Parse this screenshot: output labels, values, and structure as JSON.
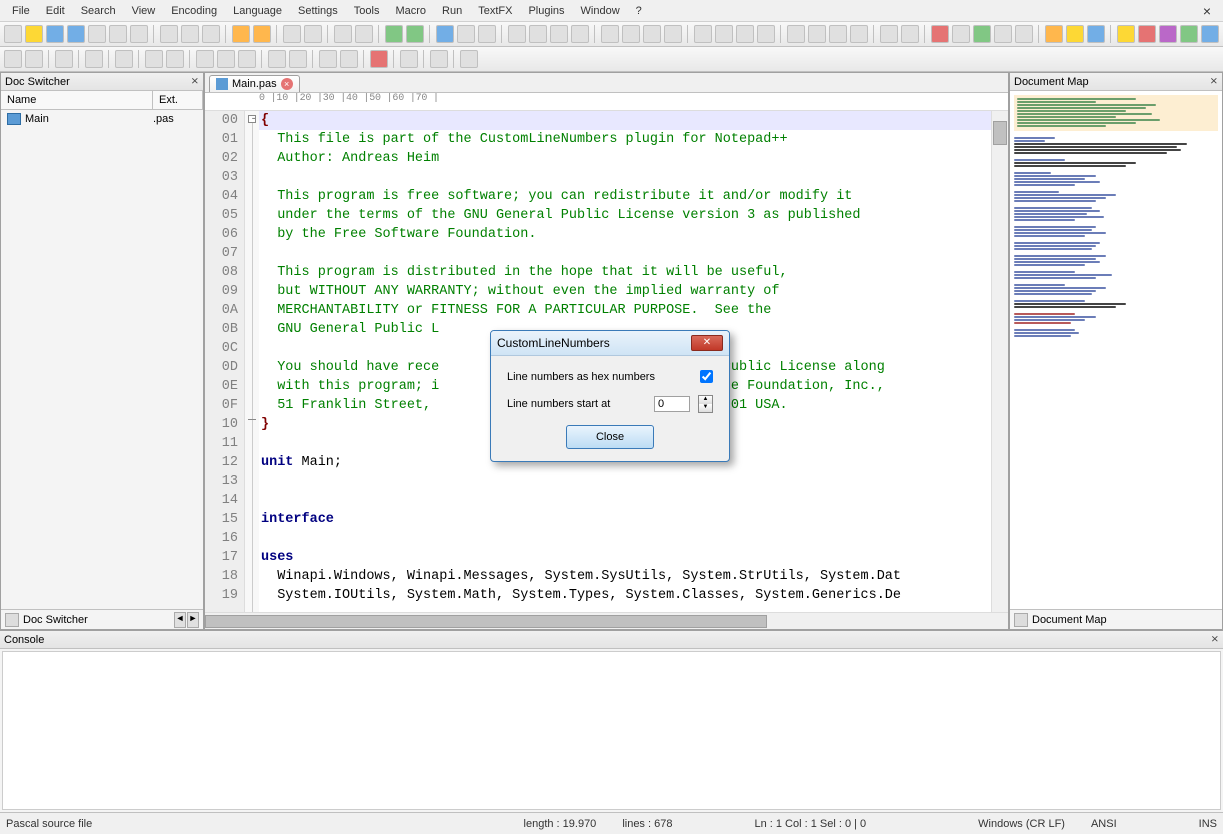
{
  "menu": [
    "File",
    "Edit",
    "Search",
    "View",
    "Encoding",
    "Language",
    "Settings",
    "Tools",
    "Macro",
    "Run",
    "TextFX",
    "Plugins",
    "Window",
    "?"
  ],
  "doc_switcher": {
    "title": "Doc Switcher",
    "col_name": "Name",
    "col_ext": "Ext.",
    "files": [
      {
        "name": "Main",
        "ext": ".pas"
      }
    ],
    "footer": "Doc Switcher"
  },
  "tab": {
    "label": "Main.pas"
  },
  "gutter_lines": [
    "00",
    "01",
    "02",
    "03",
    "04",
    "05",
    "06",
    "07",
    "08",
    "09",
    "0A",
    "0B",
    "0C",
    "0D",
    "0E",
    "0F",
    "10",
    "11",
    "12",
    "13",
    "14",
    "15",
    "16",
    "17",
    "18",
    "19"
  ],
  "code": {
    "l00": "{",
    "l01": "  This file is part of the CustomLineNumbers plugin for Notepad++",
    "l02": "  Author: Andreas Heim",
    "l03": "",
    "l04": "  This program is free software; you can redistribute it and/or modify it",
    "l05": "  under the terms of the GNU General Public License version 3 as published",
    "l06": "  by the Free Software Foundation.",
    "l07": "",
    "l08": "  This program is distributed in the hope that it will be useful,",
    "l09": "  but WITHOUT ANY WARRANTY; without even the implied warranty of",
    "l0A": "  MERCHANTABILITY or FITNESS FOR A PARTICULAR PURPOSE.  See the",
    "l0B": "  GNU General Public L",
    "l0C": "",
    "l0D": "  You should have rece                               ral Public License along",
    "l0E": "  with this program; i                               ftware Foundation, Inc.,",
    "l0F": "  51 Franklin Street,                                10-1301 USA.",
    "l10": "}",
    "l11": "",
    "l12a": "unit",
    "l12b": " Main;",
    "l13": "",
    "l14": "",
    "l15": "interface",
    "l16": "",
    "l17": "uses",
    "l18": "  Winapi.Windows, Winapi.Messages, System.SysUtils, System.StrUtils, System.Dat",
    "l19": "  System.IOUtils, System.Math, System.Types, System.Classes, System.Generics.De"
  },
  "docmap": {
    "title": "Document Map",
    "footer": "Document Map"
  },
  "console": {
    "title": "Console"
  },
  "dialog": {
    "title": "CustomLineNumbers",
    "hex_label": "Line numbers as hex numbers",
    "hex_checked": true,
    "start_label": "Line numbers start at",
    "start_value": "0",
    "close": "Close"
  },
  "status": {
    "lang": "Pascal source file",
    "length": "length : 19.970",
    "lines": "lines : 678",
    "pos": "Ln : 1    Col : 1    Sel : 0 | 0",
    "eol": "Windows (CR LF)",
    "enc": "ANSI",
    "ins": "INS"
  },
  "ruler": "0        |10       |20       |30       |40       |50       |60       |70       |"
}
